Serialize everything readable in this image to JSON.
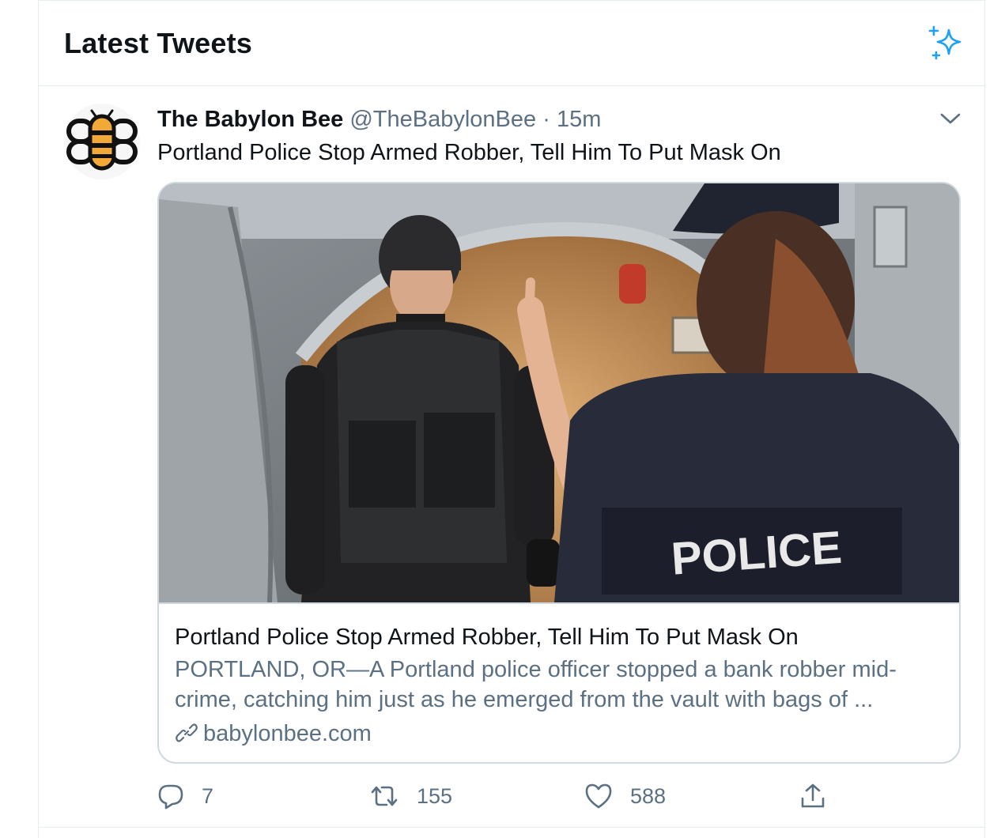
{
  "header": {
    "title": "Latest Tweets",
    "sparkle_icon": "sparkle-icon",
    "accent_color": "#1da1f2"
  },
  "tweet": {
    "display_name": "The Babylon Bee",
    "handle": "@TheBabylonBee",
    "separator": "·",
    "time": "15m",
    "text": "Portland Police Stop Armed Robber, Tell Him To Put Mask On",
    "avatar_icon": "babylon-bee-logo",
    "card": {
      "image_label": "POLICE",
      "title": "Portland Police Stop Armed Robber, Tell Him To Put Mask On",
      "description": "PORTLAND, OR—A Portland police officer stopped a bank robber mid-crime, catching him just as he emerged from the vault with bags of ...",
      "domain": "babylonbee.com",
      "link_icon": "link-icon"
    },
    "actions": {
      "replies": "7",
      "retweets": "155",
      "likes": "588"
    }
  }
}
